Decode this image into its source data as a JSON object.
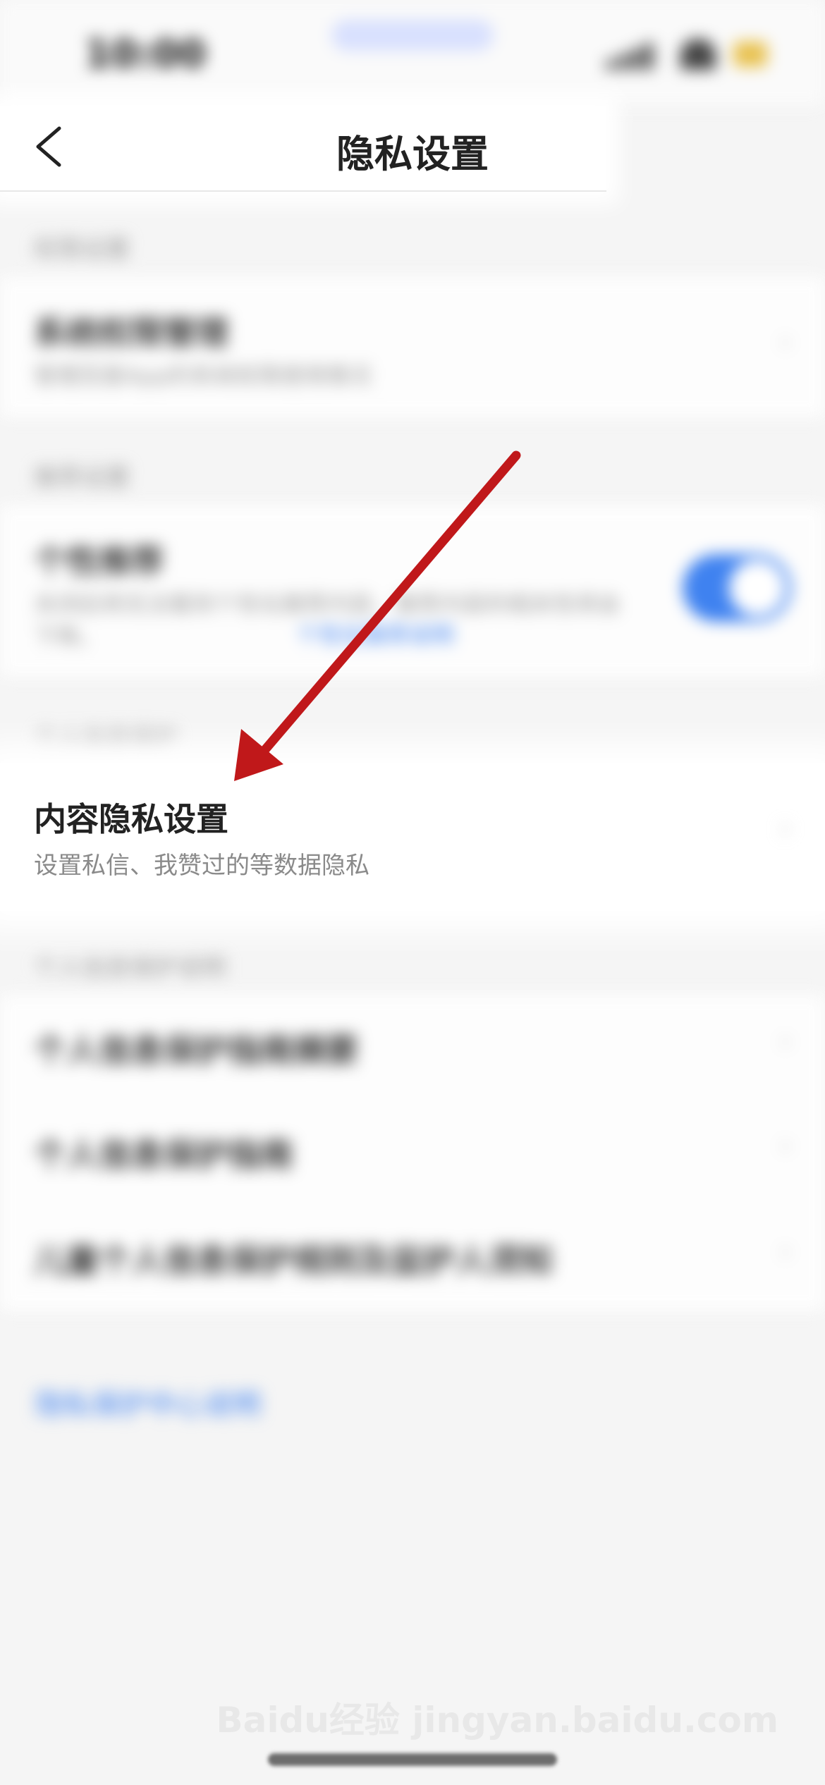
{
  "status_bar": {
    "time": "10:00"
  },
  "header": {
    "title": "隐私设置"
  },
  "sections": [
    {
      "header": "权限设置",
      "rows": [
        {
          "title": "系统权限管理",
          "subtitle": "管理百度App的系统权限使用情况"
        }
      ]
    },
    {
      "header": "推荐设置",
      "rows": [
        {
          "title": "个性推荐",
          "subtitle": "关闭后将无法看到个性化推荐内容，推荐内容的相关性将会下降。",
          "link": "个性化推荐说明",
          "toggle_on": true
        }
      ]
    },
    {
      "header": "个人信息保护",
      "rows": [
        {
          "title": "内容隐私设置",
          "subtitle": "设置私信、我赞过的等数据隐私"
        }
      ]
    },
    {
      "header": "个人信息保护说明",
      "rows": [
        {
          "title": "个人信息保护指南摘要"
        },
        {
          "title": "个人信息保护指南"
        },
        {
          "title": "儿童个人信息保护规则及监护人须知"
        }
      ]
    }
  ],
  "footer": {
    "link": "隐私保护中心说明"
  },
  "watermark": "Baidu经验 jingyan.baidu.com",
  "colors": {
    "accent": "#3f82f0",
    "annotation_arrow": "#c0181a"
  }
}
